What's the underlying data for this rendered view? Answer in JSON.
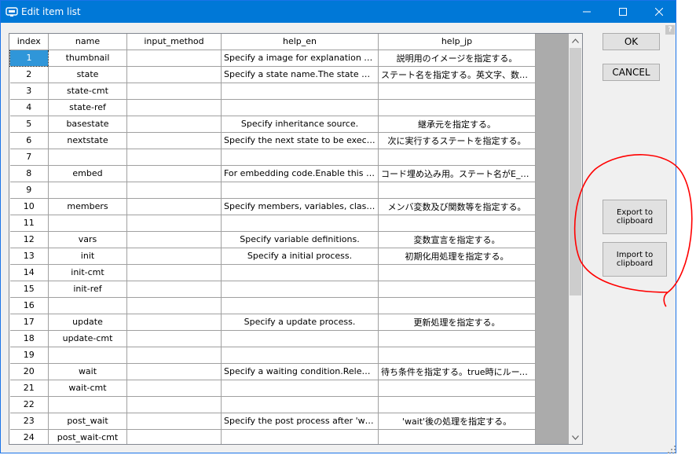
{
  "window": {
    "title": "Edit item list",
    "help_glyph": "?"
  },
  "colors": {
    "titlebar": "#0078d7",
    "selection": "#2f96d9",
    "annotation": "#ff0000"
  },
  "grid": {
    "headers": [
      "index",
      "name",
      "input_method",
      "help_en",
      "help_jp"
    ],
    "rows": [
      {
        "index": "1",
        "name": "thumbnail",
        "input_method": "",
        "help_en": "Specify a image for explanation of t...",
        "help_jp": "説明用のイメージを指定する。"
      },
      {
        "index": "2",
        "name": "state",
        "input_method": "",
        "help_en": "Specify a state name.The state nam...",
        "help_jp": "ステート名を指定する。英文字、数字、..."
      },
      {
        "index": "3",
        "name": "state-cmt",
        "input_method": "",
        "help_en": "",
        "help_jp": ""
      },
      {
        "index": "4",
        "name": "state-ref",
        "input_method": "",
        "help_en": "",
        "help_jp": ""
      },
      {
        "index": "5",
        "name": "basestate",
        "input_method": "",
        "help_en": "Specify inheritance source.",
        "help_jp": "継承元を指定する。"
      },
      {
        "index": "6",
        "name": "nextstate",
        "input_method": "",
        "help_en": "Specify the next state to be execut...",
        "help_jp": "次に実行するステートを指定する。"
      },
      {
        "index": "7",
        "name": "",
        "input_method": "",
        "help_en": "",
        "help_jp": ""
      },
      {
        "index": "8",
        "name": "embed",
        "input_method": "",
        "help_en": "For embedding code.Enable this sec...",
        "help_jp": "コード埋め込み用。ステート名がE_時に..."
      },
      {
        "index": "9",
        "name": "",
        "input_method": "",
        "help_en": "",
        "help_jp": ""
      },
      {
        "index": "10",
        "name": "members",
        "input_method": "",
        "help_en": "Specify members, variables, classes,...",
        "help_jp": "メンバ変数及び関数等を指定する。"
      },
      {
        "index": "11",
        "name": "",
        "input_method": "",
        "help_en": "",
        "help_jp": ""
      },
      {
        "index": "12",
        "name": "vars",
        "input_method": "",
        "help_en": "Specify variable definitions.",
        "help_jp": "変数宣言を指定する。"
      },
      {
        "index": "13",
        "name": "init",
        "input_method": "",
        "help_en": "Specify a initial process.",
        "help_jp": "初期化用処理を指定する。"
      },
      {
        "index": "14",
        "name": "init-cmt",
        "input_method": "",
        "help_en": "",
        "help_jp": ""
      },
      {
        "index": "15",
        "name": "init-ref",
        "input_method": "",
        "help_en": "",
        "help_jp": ""
      },
      {
        "index": "16",
        "name": "",
        "input_method": "",
        "help_en": "",
        "help_jp": ""
      },
      {
        "index": "17",
        "name": "update",
        "input_method": "",
        "help_en": "Specify a update process.",
        "help_jp": "更新処理を指定する。"
      },
      {
        "index": "18",
        "name": "update-cmt",
        "input_method": "",
        "help_en": "",
        "help_jp": ""
      },
      {
        "index": "19",
        "name": "",
        "input_method": "",
        "help_en": "",
        "help_jp": ""
      },
      {
        "index": "20",
        "name": "wait",
        "input_method": "",
        "help_en": "Specify a waiting condition.Release ...",
        "help_jp": "待ち条件を指定する。true時にループを..."
      },
      {
        "index": "21",
        "name": "wait-cmt",
        "input_method": "",
        "help_en": "",
        "help_jp": ""
      },
      {
        "index": "22",
        "name": "",
        "input_method": "",
        "help_en": "",
        "help_jp": ""
      },
      {
        "index": "23",
        "name": "post_wait",
        "input_method": "",
        "help_en": "Specify the post process after 'wait'.",
        "help_jp": "'wait'後の処理を指定する。"
      },
      {
        "index": "24",
        "name": "post_wait-cmt",
        "input_method": "",
        "help_en": "",
        "help_jp": ""
      }
    ]
  },
  "buttons": {
    "ok": "OK",
    "cancel": "CANCEL",
    "export": "Export to clipboard",
    "import": "Import to clipboard"
  }
}
